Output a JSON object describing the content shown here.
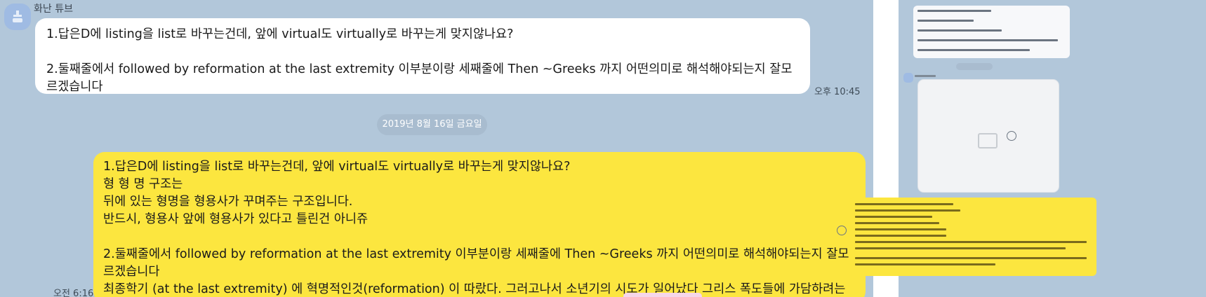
{
  "chat": {
    "sender_name": "화난 튜브",
    "incoming": {
      "text": "1.답은D에 listing을 list로 바꾸는건데, 앞에 virtual도 virtually로 바꾸는게 맞지않나요?\n\n2.둘째줄에서 followed by reformation at the last extremity 이부분이랑 세째줄에 Then ~Greeks 까지 어떤의미로 해석해야되는지 잘모르겠습니다",
      "time": "오후 10:45"
    },
    "date_divider": "2019년 8월 16일 금요일",
    "outgoing": {
      "text": "1.답은D에 listing을 list로 바꾸는건데, 앞에 virtual도 virtually로 바꾸는게 맞지않나요?\n형 형 명 구조는\n뒤에 있는 형명을 형용사가 꾸며주는 구조입니다.\n반드시, 형용사 앞에 형용사가 있다고 틀린건 아니쥬\n\n2.둘째줄에서 followed by reformation at the last extremity 이부분이랑 세째줄에 Then ~Greeks 까지 어떤의미로 해석해야되는지 잘모르겠습니다\n최종학기 (at the last extremity) 에 혁명적인것(reformation) 이 따랐다. 그러고나서 소년기의 시도가 일어났다 그리스 폭도들에 가담하려는",
      "time": "오전 6:16"
    }
  },
  "colors": {
    "chat_background": "#b2c7da",
    "incoming_bubble": "#ffffff",
    "outgoing_bubble": "#fce63f",
    "avatar": "#9fbbe3"
  },
  "icons": {
    "avatar": "person-silhouette-icon",
    "thumbnail_image_placeholder": "image-icon",
    "thumbnail_emoji": "smiley-icon"
  }
}
